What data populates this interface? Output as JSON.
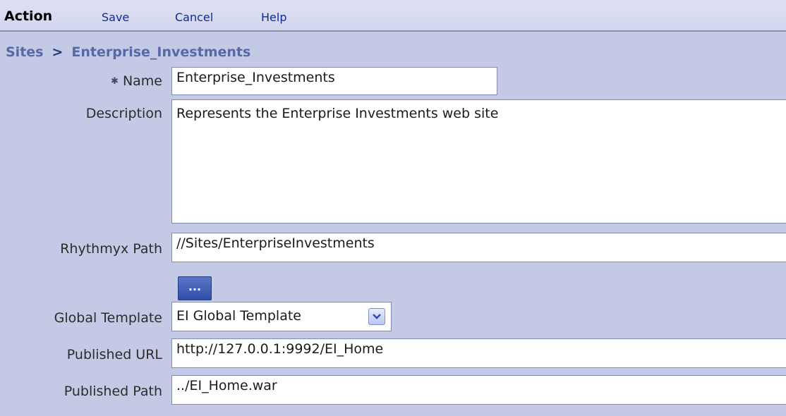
{
  "menubar": {
    "action": "Action",
    "save": "Save",
    "cancel": "Cancel",
    "help": "Help"
  },
  "breadcrumb": {
    "root": "Sites",
    "separator": ">",
    "current": "Enterprise_Investments"
  },
  "form": {
    "name": {
      "label": "Name",
      "value": "Enterprise_Investments",
      "required": true
    },
    "description": {
      "label": "Description",
      "value": "Represents the Enterprise Investments web site"
    },
    "rhythmyx_path": {
      "label": "Rhythmyx Path",
      "value": "//Sites/EnterpriseInvestments",
      "browse_label": "..."
    },
    "global_template": {
      "label": "Global Template",
      "value": "EI Global Template"
    },
    "published_url": {
      "label": "Published URL",
      "value": "http://127.0.0.1:9992/EI_Home"
    },
    "published_path": {
      "label": "Published Path",
      "value": "../EI_Home.war"
    }
  },
  "icons": {
    "required": "required-asterisk-icon",
    "dropdown": "chevron-down-icon"
  },
  "colors": {
    "background": "#c4c9e6",
    "menu_link": "#0f2a99",
    "breadcrumb": "#5569a8",
    "button": "#2f4fa8"
  }
}
